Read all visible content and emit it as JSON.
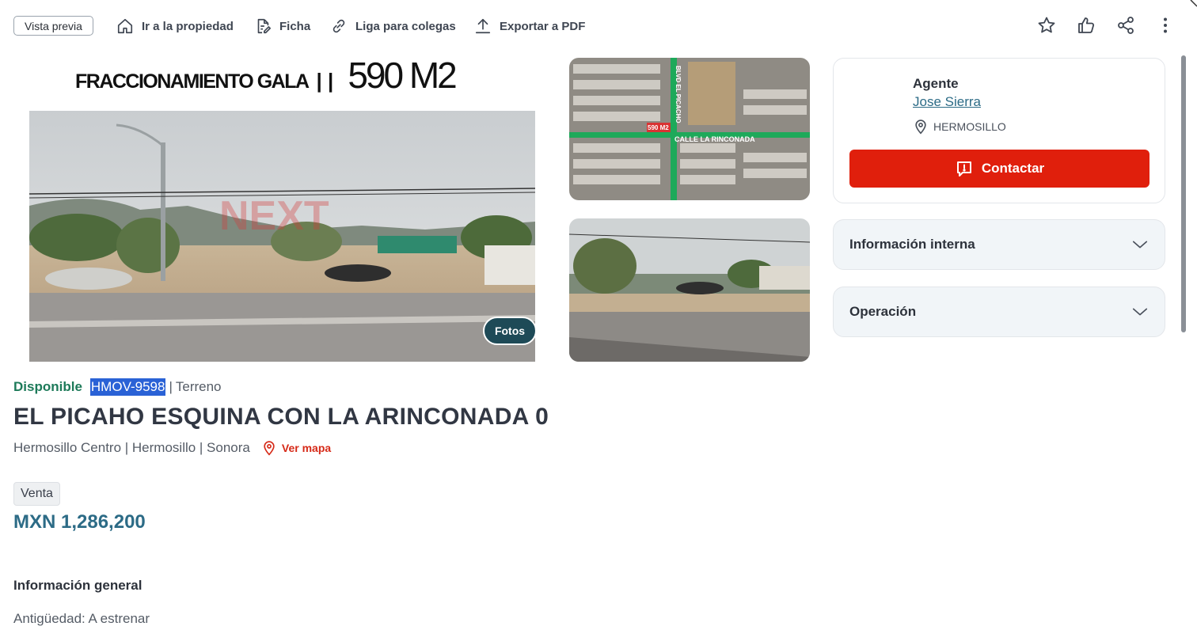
{
  "toolbar": {
    "preview": "Vista previa",
    "go_to_property": "Ir a la propiedad",
    "sheet": "Ficha",
    "colleague_link": "Liga para colegas",
    "export_pdf": "Exportar a PDF",
    "icons": [
      "star-icon",
      "thumbs-up-icon",
      "share-icon",
      "more-vertical-icon"
    ]
  },
  "hero": {
    "overlay_left": "FRACCIONAMIENTO GALA",
    "overlay_sep": "| |",
    "overlay_right": "590 M2",
    "watermark": "NEXT",
    "photos_button": "Fotos"
  },
  "map_thumb": {
    "street_1": "BLVD EL PICACHO",
    "street_2": "CALLE LA RINCONADA",
    "marker": "590 M2"
  },
  "property": {
    "status": "Disponible",
    "code": "HMOV-9598",
    "type_sep": "|",
    "type": "Terreno",
    "title": "EL PICAHO ESQUINA CON LA ARINCONADA 0",
    "location": "Hermosillo Centro | Hermosillo | Sonora",
    "map_link": "Ver mapa",
    "operation": "Venta",
    "price": "MXN 1,286,200",
    "general_title": "Información general",
    "age": "Antigüedad: A estrenar"
  },
  "agent": {
    "label": "Agente",
    "name": "Jose Sierra",
    "city": "HERMOSILLO",
    "contact": "Contactar"
  },
  "accordions": {
    "internal": "Información interna",
    "operation": "Operación"
  },
  "colors": {
    "accent_red": "#e01f0c",
    "status_green": "#1d7a59",
    "price_blue": "#2c6b86",
    "photos_btn": "#1e4a57"
  }
}
